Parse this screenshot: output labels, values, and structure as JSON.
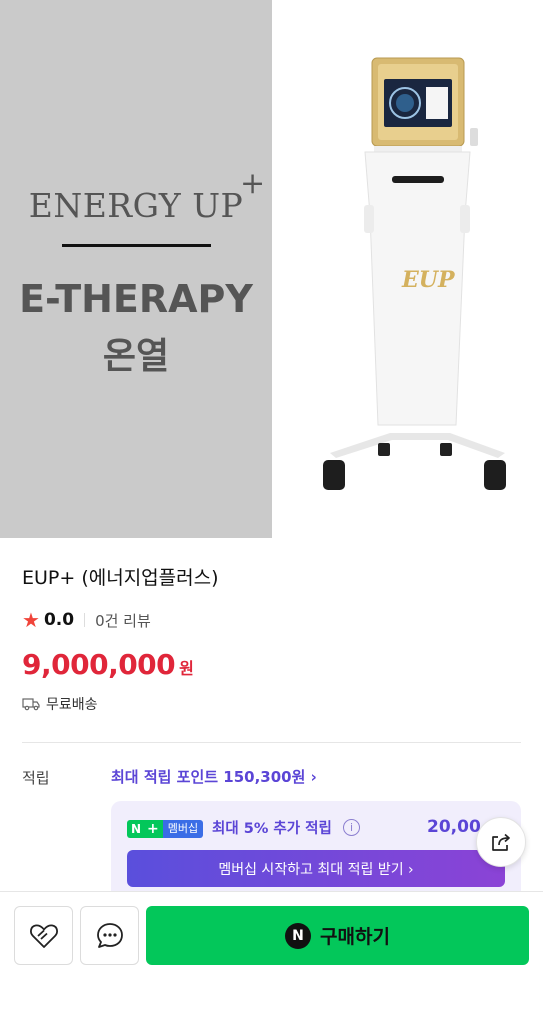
{
  "hero": {
    "brand_en": "ENERGY UP",
    "brand_plus": "+",
    "brand_sub": "E-THERAPY",
    "brand_kor": "온열",
    "device_logo": "E UP+"
  },
  "product": {
    "title": "EUP+ (에너지업플러스)",
    "rating": "0.0",
    "review_text": "0건 리뷰",
    "price": "9,000,000",
    "currency": "원",
    "shipping": "무료배송"
  },
  "points": {
    "label": "적립",
    "link": "최대 적립 포인트 150,300원 ›",
    "npay_n": "N",
    "npay_plus": "+",
    "npay_label": "멤버십",
    "member_text": "최대 5% 추가 적립",
    "member_amount": "20,00",
    "member_cta": "멤버십 시작하고 최대 적립 받기 ›"
  },
  "bottom": {
    "buy_label": "구매하기",
    "n_logo": "N"
  },
  "colors": {
    "accent_price": "#e0263a",
    "accent_purple": "#5b45d6",
    "buy_green": "#03c75a",
    "star": "#f0443a"
  },
  "icons": [
    "star-icon",
    "truck-icon",
    "info-icon",
    "share-icon",
    "heart-icon",
    "chat-icon"
  ]
}
